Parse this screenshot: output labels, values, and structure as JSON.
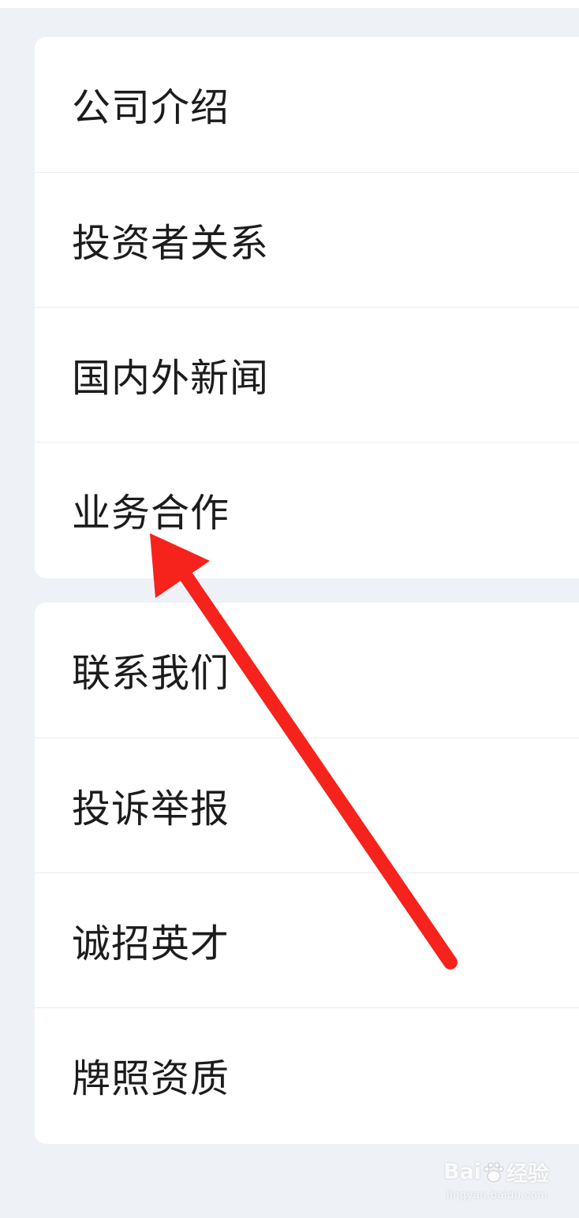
{
  "menu_groups": [
    {
      "items": [
        {
          "label": "公司介绍"
        },
        {
          "label": "投资者关系"
        },
        {
          "label": "国内外新闻"
        },
        {
          "label": "业务合作"
        }
      ]
    },
    {
      "items": [
        {
          "label": "联系我们"
        },
        {
          "label": "投诉举报"
        },
        {
          "label": "诚招英才"
        },
        {
          "label": "牌照资质"
        }
      ]
    }
  ],
  "annotation": {
    "icon": "red-arrow-icon",
    "color": "#f5231c"
  },
  "watermark": {
    "logo_left": "Bai",
    "logo_right": "经验",
    "url": "jingyan.baidu.com"
  },
  "colors": {
    "background": "#eef2f7",
    "card": "#ffffff",
    "text": "#1c1c1c",
    "divider": "#ececec"
  }
}
